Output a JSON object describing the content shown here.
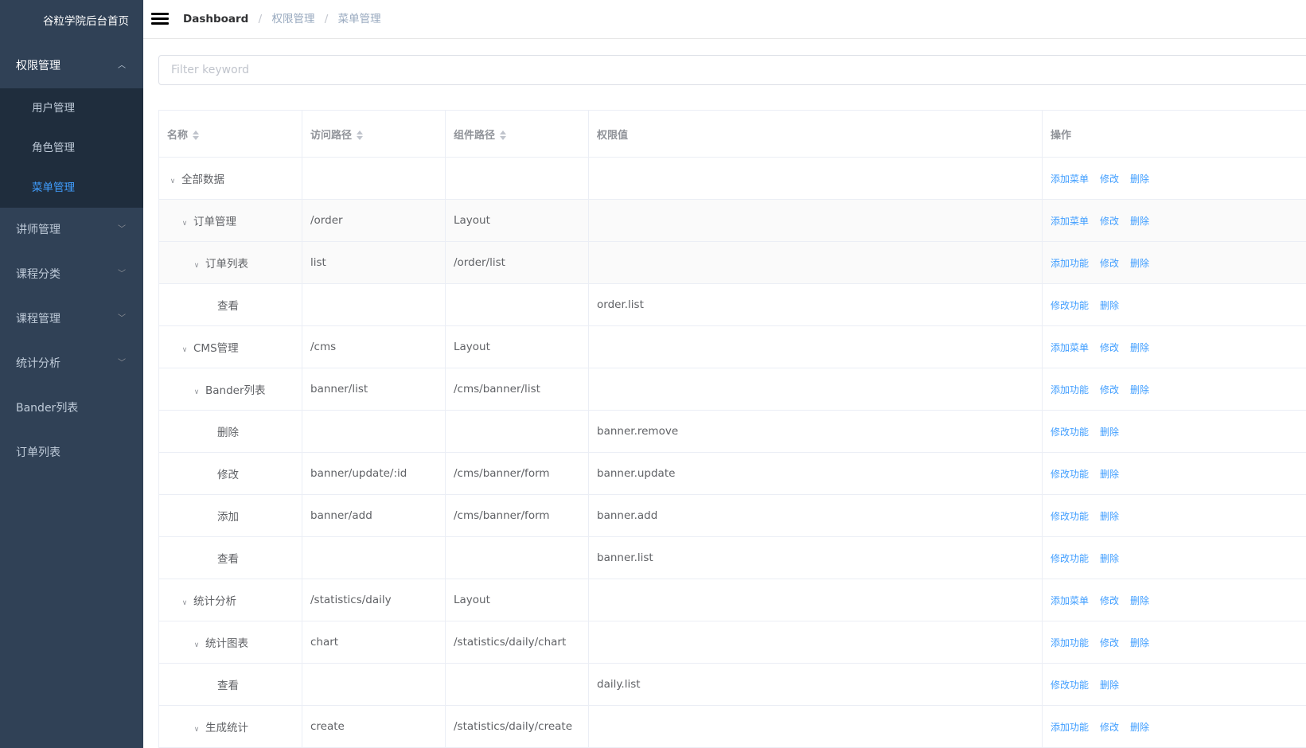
{
  "sidebar": {
    "brand": "谷粒学院后台首页",
    "group_open": "权限管理",
    "sub_items": [
      "用户管理",
      "角色管理",
      "菜单管理"
    ],
    "active_sub": "菜单管理",
    "groups": [
      "讲师管理",
      "课程分类",
      "课程管理",
      "统计分析"
    ],
    "links": [
      "Bander列表",
      "订单列表"
    ]
  },
  "navbar": {
    "breadcrumb": [
      "Dashboard",
      "权限管理",
      "菜单管理"
    ],
    "separator": "/"
  },
  "filter": {
    "placeholder": "Filter keyword",
    "value": ""
  },
  "table": {
    "headers": [
      "名称",
      "访问路径",
      "组件路径",
      "权限值",
      "操作"
    ],
    "rows": [
      {
        "name": "全部数据",
        "level": 0,
        "expand": true,
        "path": "",
        "component": "",
        "value": "",
        "ops": [
          "添加菜单",
          "修改",
          "删除"
        ]
      },
      {
        "name": "订单管理",
        "level": 1,
        "expand": true,
        "path": "/order",
        "component": "Layout",
        "value": "",
        "ops": [
          "添加菜单",
          "修改",
          "删除"
        ]
      },
      {
        "name": "订单列表",
        "level": 2,
        "expand": true,
        "path": "list",
        "component": "/order/list",
        "value": "",
        "ops": [
          "添加功能",
          "修改",
          "删除"
        ]
      },
      {
        "name": "查看",
        "level": 3,
        "expand": false,
        "path": "",
        "component": "",
        "value": "order.list",
        "ops": [
          "修改功能",
          "删除"
        ]
      },
      {
        "name": "CMS管理",
        "level": 1,
        "expand": true,
        "path": "/cms",
        "component": "Layout",
        "value": "",
        "ops": [
          "添加菜单",
          "修改",
          "删除"
        ]
      },
      {
        "name": "Bander列表",
        "level": 2,
        "expand": true,
        "path": "banner/list",
        "component": "/cms/banner/list",
        "value": "",
        "ops": [
          "添加功能",
          "修改",
          "删除"
        ]
      },
      {
        "name": "删除",
        "level": 3,
        "expand": false,
        "path": "",
        "component": "",
        "value": "banner.remove",
        "ops": [
          "修改功能",
          "删除"
        ]
      },
      {
        "name": "修改",
        "level": 3,
        "expand": false,
        "path": "banner/update/:id",
        "component": "/cms/banner/form",
        "value": "banner.update",
        "ops": [
          "修改功能",
          "删除"
        ]
      },
      {
        "name": "添加",
        "level": 3,
        "expand": false,
        "path": "banner/add",
        "component": "/cms/banner/form",
        "value": "banner.add",
        "ops": [
          "修改功能",
          "删除"
        ]
      },
      {
        "name": "查看",
        "level": 3,
        "expand": false,
        "path": "",
        "component": "",
        "value": "banner.list",
        "ops": [
          "修改功能",
          "删除"
        ]
      },
      {
        "name": "统计分析",
        "level": 1,
        "expand": true,
        "path": "/statistics/daily",
        "component": "Layout",
        "value": "",
        "ops": [
          "添加菜单",
          "修改",
          "删除"
        ]
      },
      {
        "name": "统计图表",
        "level": 2,
        "expand": true,
        "path": "chart",
        "component": "/statistics/daily/chart",
        "value": "",
        "ops": [
          "添加功能",
          "修改",
          "删除"
        ]
      },
      {
        "name": "查看",
        "level": 3,
        "expand": false,
        "path": "",
        "component": "",
        "value": "daily.list",
        "ops": [
          "修改功能",
          "删除"
        ]
      },
      {
        "name": "生成统计",
        "level": 2,
        "expand": true,
        "path": "create",
        "component": "/statistics/daily/create",
        "value": "",
        "ops": [
          "添加功能",
          "修改",
          "删除"
        ]
      }
    ]
  },
  "colors": {
    "sidebar_bg": "#304156",
    "submenu_bg": "#1f2d3d",
    "accent": "#409eff",
    "text": "#606266"
  }
}
